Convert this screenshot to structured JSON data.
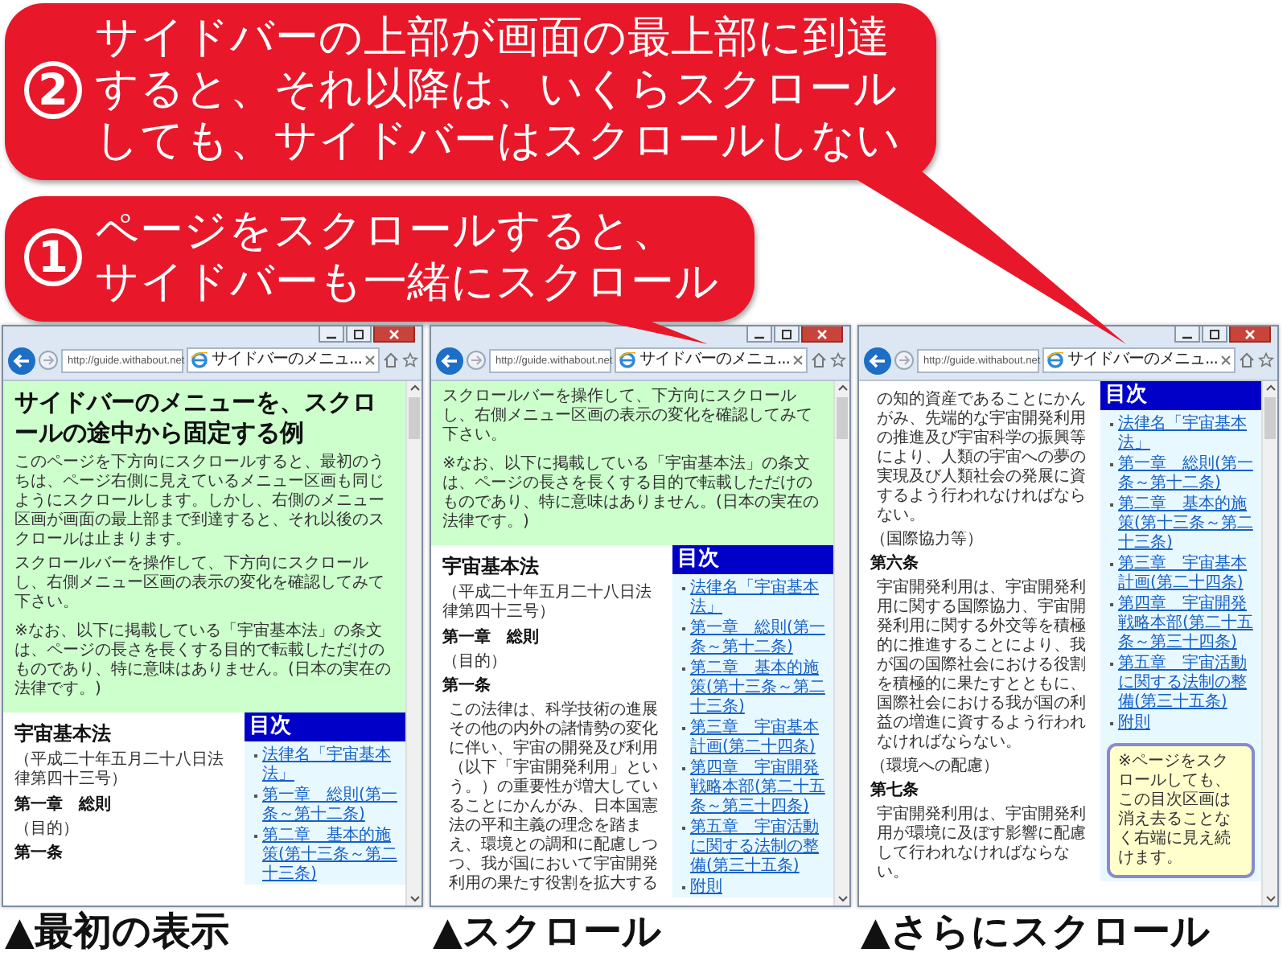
{
  "callouts": [
    {
      "number": "2",
      "lines": [
        "サイドバーの上部が画面の最上部に到達",
        "すると、それ以降は、いくらスクロール",
        "しても、サイドバーはスクロールしない"
      ]
    },
    {
      "number": "1",
      "lines": [
        "ページをスクロールすると、",
        "サイドバーも一緒にスクロール"
      ]
    }
  ],
  "windows": [
    {
      "caption": "▲最初の表示",
      "url": "http://guide.withabout.net",
      "tab_title": "サイドバーのメニュ...",
      "header": [
        {
          "kind": "title",
          "text": "サイドバーのメニューを、スクロールの途中から固定する例"
        },
        {
          "kind": "text",
          "text": "このページを下方向にスクロールすると、最初のうちは、ページ右側に見えているメニュー区画も同じようにスクロールします。しかし、右側のメニュー区画が画面の最上部まで到達すると、それ以後のスクロールは止まります。"
        },
        {
          "kind": "text",
          "text": "スクロールバーを操作して、下方向にスクロールし、右側メニュー区画の表示の変化を確認してみて下さい。"
        },
        {
          "kind": "note",
          "text": "※なお、以下に掲載している「宇宙基本法」の条文は、ページの長さを長くする目的で転載しただけのものであり、特に意味はありません。(日本の実在の法律です。)"
        }
      ],
      "main": [
        {
          "kind": "law-title",
          "text": "宇宙基本法"
        },
        {
          "kind": "law-number",
          "text": "（平成二十年五月二十八日法律第四十三号）"
        },
        {
          "kind": "chapter",
          "text": "第一章　総則"
        },
        {
          "kind": "caption",
          "text": "（目的）"
        },
        {
          "kind": "article",
          "text": "第一条"
        }
      ],
      "sidebar": {
        "heading": "目次",
        "items": [
          "法律名「宇宙基本法」",
          "第一章　総則(第一条～第十二条)",
          "第二章　基本的施策(第十三条～第二十三条)"
        ]
      }
    },
    {
      "caption": "▲スクロール",
      "url": "http://guide.withabout.net",
      "tab_title": "サイドバーのメニュ...",
      "header": [
        {
          "kind": "text",
          "text": "スクロールバーを操作して、下方向にスクロールし、右側メニュー区画の表示の変化を確認してみて下さい。"
        },
        {
          "kind": "note",
          "text": "※なお、以下に掲載している「宇宙基本法」の条文は、ページの長さを長くする目的で転載しただけのものであり、特に意味はありません。(日本の実在の法律です。)"
        }
      ],
      "main": [
        {
          "kind": "law-title",
          "text": "宇宙基本法"
        },
        {
          "kind": "law-number",
          "text": "（平成二十年五月二十八日法律第四十三号）"
        },
        {
          "kind": "chapter",
          "text": "第一章　総則"
        },
        {
          "kind": "caption",
          "text": "（目的）"
        },
        {
          "kind": "article",
          "text": "第一条"
        },
        {
          "kind": "paragraph",
          "text": "この法律は、科学技術の進展その他の内外の諸情勢の変化に伴い、宇宙の開発及び利用（以下「宇宙開発利用」という。）の重要性が増大していることにかんがみ、日本国憲法の平和主義の理念を踏まえ、環境との調和に配慮しつつ、我が国において宇宙開発利用の果たす役割を拡大する"
        }
      ],
      "sidebar": {
        "heading": "目次",
        "items": [
          "法律名「宇宙基本法」",
          "第一章　総則(第一条～第十二条)",
          "第二章　基本的施策(第十三条～第二十三条)",
          "第三章　宇宙基本計画(第二十四条)",
          "第四章　宇宙開発戦略本部(第二十五条～第三十四条)",
          "第五章　宇宙活動に関する法制の整備(第三十五条)",
          "附則"
        ]
      }
    },
    {
      "caption": "▲さらにスクロール",
      "url": "http://guide.withabout.net",
      "tab_title": "サイドバーのメニュ...",
      "main": [
        {
          "kind": "paragraph",
          "text": "の知的資産であることにかんがみ、先端的な宇宙開発利用の推進及び宇宙科学の振興等により、人類の宇宙への夢の実現及び人類社会の発展に資するよう行われなければならない。"
        },
        {
          "kind": "caption",
          "text": "（国際協力等）"
        },
        {
          "kind": "article",
          "text": "第六条"
        },
        {
          "kind": "paragraph",
          "text": "宇宙開発利用は、宇宙開発利用に関する国際協力、宇宙開発利用に関する外交等を積極的に推進することにより、我が国の国際社会における役割を積極的に果たすとともに、国際社会における我が国の利益の増進に資するよう行われなければならない。"
        },
        {
          "kind": "caption",
          "text": "（環境への配慮）"
        },
        {
          "kind": "article",
          "text": "第七条"
        },
        {
          "kind": "paragraph",
          "text": "宇宙開発利用は、宇宙開発利用が環境に及ぼす影響に配慮して行われなければならない。"
        }
      ],
      "sidebar": {
        "heading": "目次",
        "items": [
          "法律名「宇宙基本法」",
          "第一章　総則(第一条～第十二条)",
          "第二章　基本的施策(第十三条～第二十三条)",
          "第三章　宇宙基本計画(第二十四条)",
          "第四章　宇宙開発戦略本部(第二十五条～第三十四条)",
          "第五章　宇宙活動に関する法制の整備(第三十五条)",
          "附則"
        ],
        "note": "※ページをスクロールしても、この目次区画は消え去ることなく右端に見え続けます。"
      }
    }
  ]
}
